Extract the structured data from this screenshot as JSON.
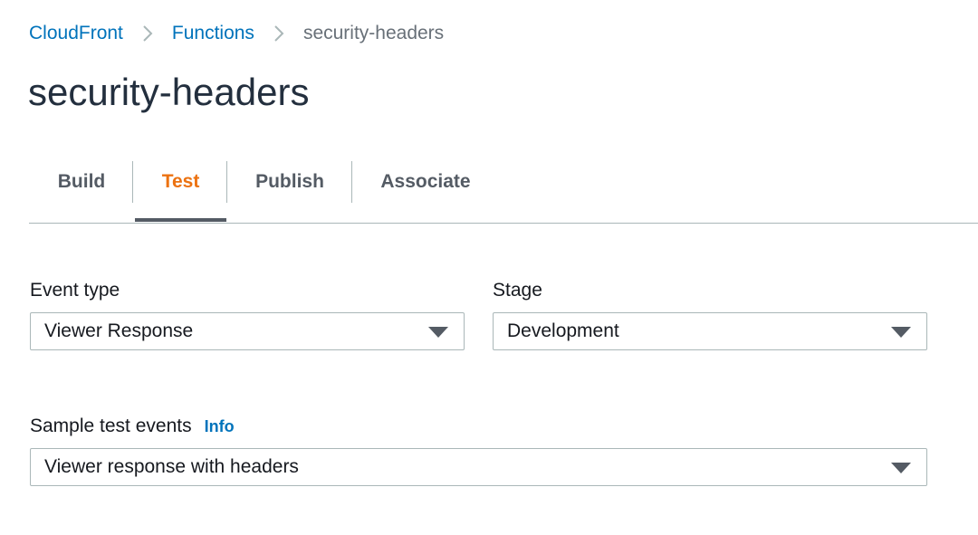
{
  "breadcrumb": {
    "items": [
      {
        "label": "CloudFront"
      },
      {
        "label": "Functions"
      },
      {
        "label": "security-headers"
      }
    ]
  },
  "page": {
    "title": "security-headers"
  },
  "tabs": [
    {
      "label": "Build",
      "active": false
    },
    {
      "label": "Test",
      "active": true
    },
    {
      "label": "Publish",
      "active": false
    },
    {
      "label": "Associate",
      "active": false
    }
  ],
  "form": {
    "event_type": {
      "label": "Event type",
      "value": "Viewer Response"
    },
    "stage": {
      "label": "Stage",
      "value": "Development"
    },
    "sample_test_events": {
      "label": "Sample test events",
      "info_label": "Info",
      "value": "Viewer response with headers"
    }
  },
  "colors": {
    "link": "#0073bb",
    "active_tab": "#ec7211",
    "text": "#16191f",
    "muted": "#687078",
    "border": "#aab7b8"
  },
  "icons": {
    "breadcrumb_separator": "chevron-right-icon",
    "select_caret": "caret-down-icon"
  }
}
